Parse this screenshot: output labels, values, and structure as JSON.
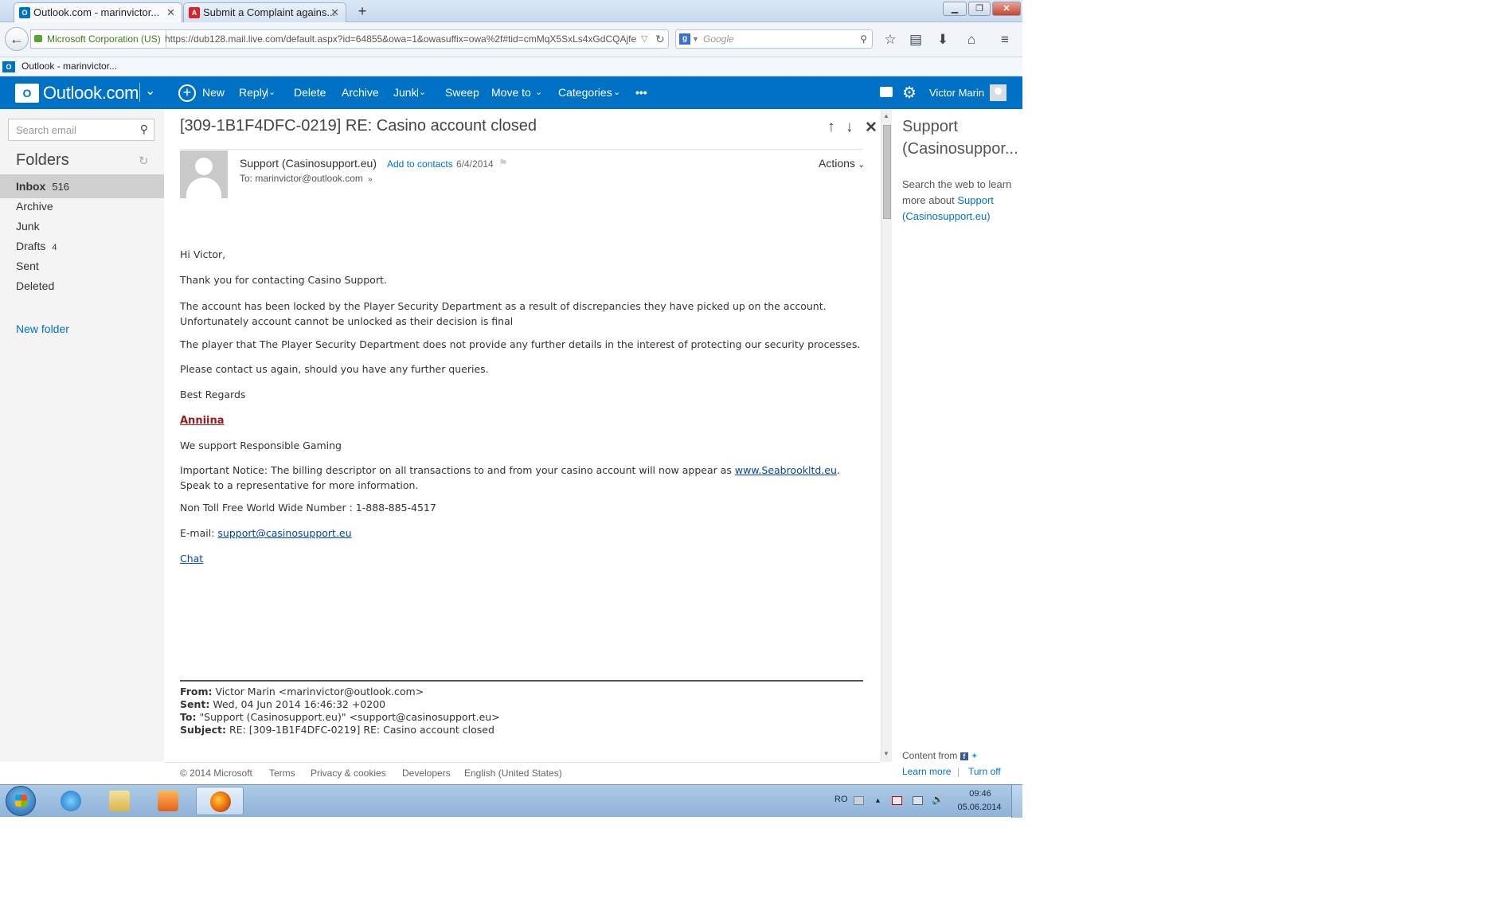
{
  "browser": {
    "tabs": [
      {
        "label": "Outlook.com - marinvictor...",
        "active": true,
        "icon": "outlook-icon"
      },
      {
        "label": "Submit a Complaint agains...",
        "active": false,
        "icon": "red-a-icon"
      }
    ],
    "new_tab": "+",
    "identity": "Microsoft Corporation (US)",
    "url": "https://dub128.mail.live.com/default.aspx?id=64855&owa=1&owasuffix=owa%2f#tid=cmMqX5SxLs4xGdCQAjfe",
    "search_placeholder": "Google",
    "bookmark_label": "Outlook - marinvictor..."
  },
  "app": {
    "brand": "Outlook.com",
    "commands": {
      "new": "New",
      "reply": "Reply",
      "delete": "Delete",
      "archive": "Archive",
      "junk": "Junk",
      "sweep": "Sweep",
      "move_to": "Move to",
      "categories": "Categories",
      "more": "•••"
    },
    "user_name": "Victor Marin"
  },
  "sidebar": {
    "search_placeholder": "Search email",
    "folders_title": "Folders",
    "folders": [
      {
        "label": "Inbox",
        "count": "516",
        "selected": true
      },
      {
        "label": "Archive",
        "count": ""
      },
      {
        "label": "Junk",
        "count": ""
      },
      {
        "label": "Drafts",
        "count": "4"
      },
      {
        "label": "Sent",
        "count": ""
      },
      {
        "label": "Deleted",
        "count": ""
      }
    ],
    "new_folder": "New folder"
  },
  "message": {
    "subject": "[309-1B1F4DFC-0219] RE: Casino account closed",
    "sender": "Support (Casinosupport.eu)",
    "add_contacts": "Add to contacts",
    "date": "6/4/2014",
    "to": "To: marinvictor@outlook.com",
    "actions": "Actions",
    "body": {
      "greeting": "Hi Victor,",
      "p1": "Thank you for contacting Casino Support.",
      "p2": "The account has been locked by the Player Security Department as a result of discrepancies they have picked up on the account. Unfortunately account cannot be unlocked as their decision is final",
      "p3": "The player that The Player Security Department does not provide any further details in the interest of protecting our security processes.",
      "p4": "Please contact us again, should you have any further queries.",
      "regards": "Best Regards",
      "signature": "Anniina",
      "tagline": "We support Responsible Gaming",
      "notice_prefix": "Important Notice: The billing descriptor on all transactions to and from your casino account will now appear as",
      "notice_link": "www.Seabrookltd.eu",
      "notice_suffix": ". Speak to a representative for more information.",
      "phone": "Non Toll Free World Wide Number : 1-888-885-4517",
      "email_label": "E-mail:",
      "email_link": "support@casinosupport.eu",
      "chat": "Chat"
    },
    "quoted": {
      "from_label": "From:",
      "from": "Victor Marin <marinvictor@outlook.com>",
      "sent_label": "Sent:",
      "sent": "Wed, 04 Jun 2014 16:46:32 +0200",
      "to_label": "To:",
      "to": "\"Support (Casinosupport.eu)\" <support@casinosupport.eu>",
      "subject_label": "Subject:",
      "subject": "RE: [309-1B1F4DFC-0219] RE: Casino account closed"
    }
  },
  "footer": {
    "copyright": "© 2014 Microsoft",
    "terms": "Terms",
    "privacy": "Privacy & cookies",
    "developers": "Developers",
    "language": "English (United States)"
  },
  "right_pane": {
    "title": "Support (Casinosuppor...",
    "text": "Search the web to learn more about",
    "link": "Support (Casinosupport.eu)",
    "content_from": "Content from",
    "learn_more": "Learn more",
    "separator": "|",
    "turn_off": "Turn off"
  },
  "taskbar": {
    "lang": "RO",
    "time": "09:46",
    "date": "05.06.2014"
  },
  "colors": {
    "brand_blue": "#0072c6",
    "signature_red": "#9b1c20"
  }
}
